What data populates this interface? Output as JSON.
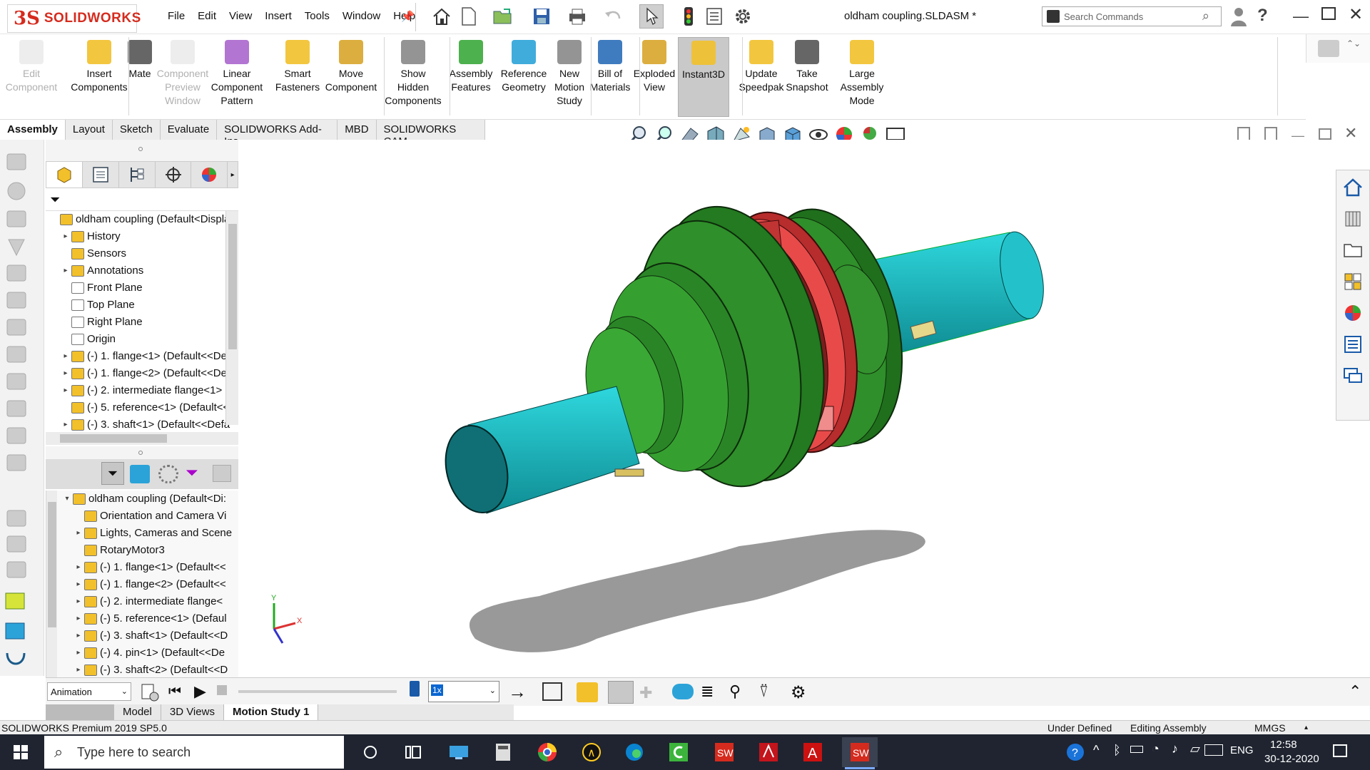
{
  "app": {
    "logo_ds": "3S",
    "logo_name": "SOLIDWORKS",
    "doc_title": "oldham coupling.SLDASM *",
    "menu": [
      "File",
      "Edit",
      "View",
      "Insert",
      "Tools",
      "Window",
      "Help"
    ],
    "search_placeholder": "Search Commands"
  },
  "ribbon": {
    "buttons": [
      {
        "label": "Edit\nComponent",
        "disabled": true
      },
      {
        "label": "Insert\nComponents",
        "disabled": false
      },
      {
        "label": "Mate",
        "disabled": false
      },
      {
        "label": "Component\nPreview\nWindow",
        "disabled": true
      },
      {
        "label": "Linear\nComponent\nPattern",
        "disabled": false
      },
      {
        "label": "Smart\nFasteners",
        "disabled": false
      },
      {
        "label": "Move\nComponent",
        "disabled": false
      },
      {
        "label": "Show\nHidden\nComponents",
        "disabled": false
      },
      {
        "label": "Assembly\nFeatures",
        "disabled": false
      },
      {
        "label": "Reference\nGeometry",
        "disabled": false
      },
      {
        "label": "New\nMotion\nStudy",
        "disabled": false
      },
      {
        "label": "Bill of\nMaterials",
        "disabled": false
      },
      {
        "label": "Exploded\nView",
        "disabled": false
      },
      {
        "label": "Instant3D",
        "disabled": false,
        "active": true
      },
      {
        "label": "Update\nSpeedpak",
        "disabled": false
      },
      {
        "label": "Take\nSnapshot",
        "disabled": false
      },
      {
        "label": "Large\nAssembly\nMode",
        "disabled": false
      }
    ]
  },
  "tabs": [
    "Assembly",
    "Layout",
    "Sketch",
    "Evaluate",
    "SOLIDWORKS Add-Ins",
    "MBD",
    "SOLIDWORKS CAM"
  ],
  "feature_tree": {
    "items": [
      {
        "label": "oldham coupling  (Default<Displa",
        "arrow": "",
        "level": 0
      },
      {
        "label": "History",
        "arrow": "▸",
        "level": 1
      },
      {
        "label": "Sensors",
        "arrow": "",
        "level": 1
      },
      {
        "label": "Annotations",
        "arrow": "▸",
        "level": 1
      },
      {
        "label": "Front Plane",
        "arrow": "",
        "level": 1
      },
      {
        "label": "Top Plane",
        "arrow": "",
        "level": 1
      },
      {
        "label": "Right Plane",
        "arrow": "",
        "level": 1
      },
      {
        "label": "Origin",
        "arrow": "",
        "level": 1
      },
      {
        "label": "(-) 1. flange<1> (Default<<De",
        "arrow": "▸",
        "level": 1
      },
      {
        "label": "(-) 1. flange<2> (Default<<De",
        "arrow": "▸",
        "level": 1
      },
      {
        "label": "(-) 2. intermediate flange<1> (",
        "arrow": "▸",
        "level": 1
      },
      {
        "label": "(-) 5. reference<1> (Default<<",
        "arrow": "",
        "level": 1
      },
      {
        "label": "(-) 3. shaft<1> (Default<<Defa",
        "arrow": "▸",
        "level": 1
      }
    ]
  },
  "motion_tree": {
    "items": [
      {
        "label": "oldham coupling  (Default<Di:",
        "arrow": "▾",
        "level": 0
      },
      {
        "label": "Orientation and Camera Vi",
        "arrow": "",
        "level": 1
      },
      {
        "label": "Lights, Cameras and Scene",
        "arrow": "▸",
        "level": 1
      },
      {
        "label": "RotaryMotor3",
        "arrow": "",
        "level": 1
      },
      {
        "label": "(-) 1. flange<1> (Default<<",
        "arrow": "▸",
        "level": 1
      },
      {
        "label": "(-) 1. flange<2> (Default<<",
        "arrow": "▸",
        "level": 1
      },
      {
        "label": "(-) 2. intermediate flange<",
        "arrow": "▸",
        "level": 1
      },
      {
        "label": "(-) 5. reference<1> (Defaul",
        "arrow": "▸",
        "level": 1
      },
      {
        "label": "(-) 3. shaft<1> (Default<<D",
        "arrow": "▸",
        "level": 1
      },
      {
        "label": "(-) 4. pin<1> (Default<<De",
        "arrow": "▸",
        "level": 1
      },
      {
        "label": "(-) 3. shaft<2> (Default<<D",
        "arrow": "▸",
        "level": 1
      }
    ]
  },
  "motion": {
    "type": "Animation",
    "speed": "1x"
  },
  "bottom_tabs": [
    "Model",
    "3D Views",
    "Motion Study 1"
  ],
  "status": {
    "left": "SOLIDWORKS Premium 2019 SP5.0",
    "state": "Under Defined",
    "mode": "Editing Assembly",
    "units": "MMGS"
  },
  "taskbar": {
    "search": "Type here to search",
    "lang": "ENG",
    "time": "12:58",
    "date": "30-12-2020"
  },
  "colors": {
    "flange_green": "#2f8f2a",
    "flange_dark": "#1e6a1a",
    "shaft_cyan": "#1fc8cf",
    "intermediate_red": "#e23c3c"
  }
}
